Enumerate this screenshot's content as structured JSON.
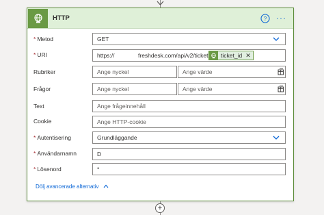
{
  "header": {
    "title": "HTTP",
    "help_glyph": "?",
    "more_glyph": "···"
  },
  "fields": {
    "method": {
      "label": "Metod",
      "value": "GET"
    },
    "uri": {
      "label": "URI",
      "value_start": "https://",
      "value_rest": "freshdesk.com/api/v2/tickets/",
      "token": "ticket_id",
      "token_close": "✕"
    },
    "headers": {
      "label": "Rubriker",
      "key_placeholder": "Ange nyckel",
      "value_placeholder": "Ange värde"
    },
    "queries": {
      "label": "Frågor",
      "key_placeholder": "Ange nyckel",
      "value_placeholder": "Ange värde"
    },
    "body": {
      "label": "Text",
      "placeholder": "Ange frågeinnehåll"
    },
    "cookie": {
      "label": "Cookie",
      "placeholder": "Ange HTTP-cookie"
    },
    "auth": {
      "label": "Autentisering",
      "value": "Grundläggande"
    },
    "username": {
      "label": "Användarnamn",
      "value": "D"
    },
    "password": {
      "label": "Lösenord",
      "value": "*"
    }
  },
  "advanced": {
    "label": "Dölj avancerade alternativ"
  },
  "required_mark": "*",
  "add_glyph": "+",
  "colors": {
    "accent": "#6a9a44",
    "link": "#0b66d6",
    "header_bg": "#dff0d8"
  },
  "icons": [
    "globe-icon",
    "help-icon",
    "more-icon",
    "chevron-down-icon",
    "table-icon",
    "chevron-up-icon",
    "add-icon"
  ]
}
